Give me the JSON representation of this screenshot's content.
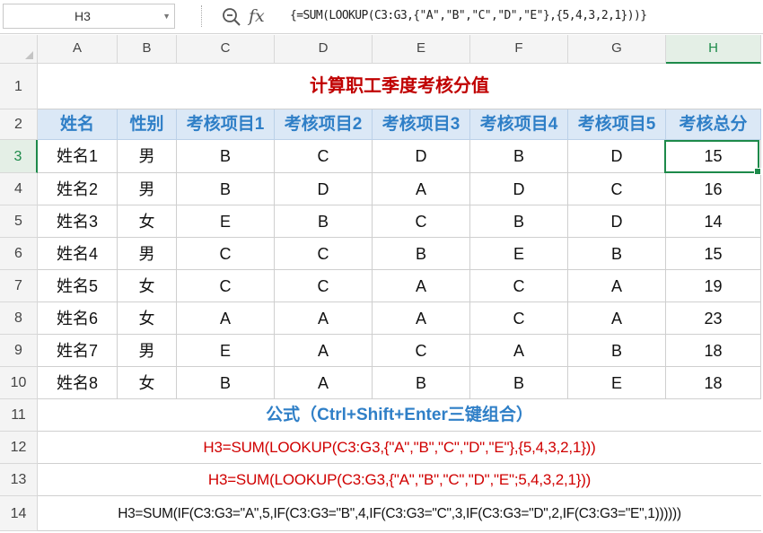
{
  "name_box": {
    "value": "H3"
  },
  "formula_bar": {
    "zoom_icon": "magnifier-icon",
    "fx_label": "fx",
    "formula": "{=SUM(LOOKUP(C3:G3,{\"A\",\"B\",\"C\",\"D\",\"E\"},{5,4,3,2,1}))}"
  },
  "columns": [
    "A",
    "B",
    "C",
    "D",
    "E",
    "F",
    "G",
    "H"
  ],
  "rows": [
    "1",
    "2",
    "3",
    "4",
    "5",
    "6",
    "7",
    "8",
    "9",
    "10",
    "11",
    "12",
    "13",
    "14"
  ],
  "selected_cell": {
    "column": "H",
    "row": "3"
  },
  "sheet": {
    "title": "计算职工季度考核分值",
    "headers": [
      "姓名",
      "性别",
      "考核项目1",
      "考核项目2",
      "考核项目3",
      "考核项目4",
      "考核项目5",
      "考核总分"
    ],
    "records": [
      [
        "姓名1",
        "男",
        "B",
        "C",
        "D",
        "B",
        "D",
        "15"
      ],
      [
        "姓名2",
        "男",
        "B",
        "D",
        "A",
        "D",
        "C",
        "16"
      ],
      [
        "姓名3",
        "女",
        "E",
        "B",
        "C",
        "B",
        "D",
        "14"
      ],
      [
        "姓名4",
        "男",
        "C",
        "C",
        "B",
        "E",
        "B",
        "15"
      ],
      [
        "姓名5",
        "女",
        "C",
        "C",
        "A",
        "C",
        "A",
        "19"
      ],
      [
        "姓名6",
        "女",
        "A",
        "A",
        "A",
        "C",
        "A",
        "23"
      ],
      [
        "姓名7",
        "男",
        "E",
        "A",
        "C",
        "A",
        "B",
        "18"
      ],
      [
        "姓名8",
        "女",
        "B",
        "A",
        "B",
        "B",
        "E",
        "18"
      ]
    ],
    "formula_title": "公式（Ctrl+Shift+Enter三键组合）",
    "formula_1": "H3=SUM(LOOKUP(C3:G3,{\"A\",\"B\",\"C\",\"D\",\"E\"},{5,4,3,2,1}))",
    "formula_2": "H3=SUM(LOOKUP(C3:G3,{\"A\",\"B\",\"C\",\"D\",\"E\";5,4,3,2,1}))",
    "formula_3": "H3=SUM(IF(C3:G3=\"A\",5,IF(C3:G3=\"B\",4,IF(C3:G3=\"C\",3,IF(C3:G3=\"D\",2,IF(C3:G3=\"E\",1))))))"
  },
  "colors": {
    "accent_green": "#1d8a4a",
    "header_fill": "#dbe8f6",
    "header_text": "#2f7fc7",
    "title_red": "#c00000",
    "formula_red": "#d00000"
  }
}
